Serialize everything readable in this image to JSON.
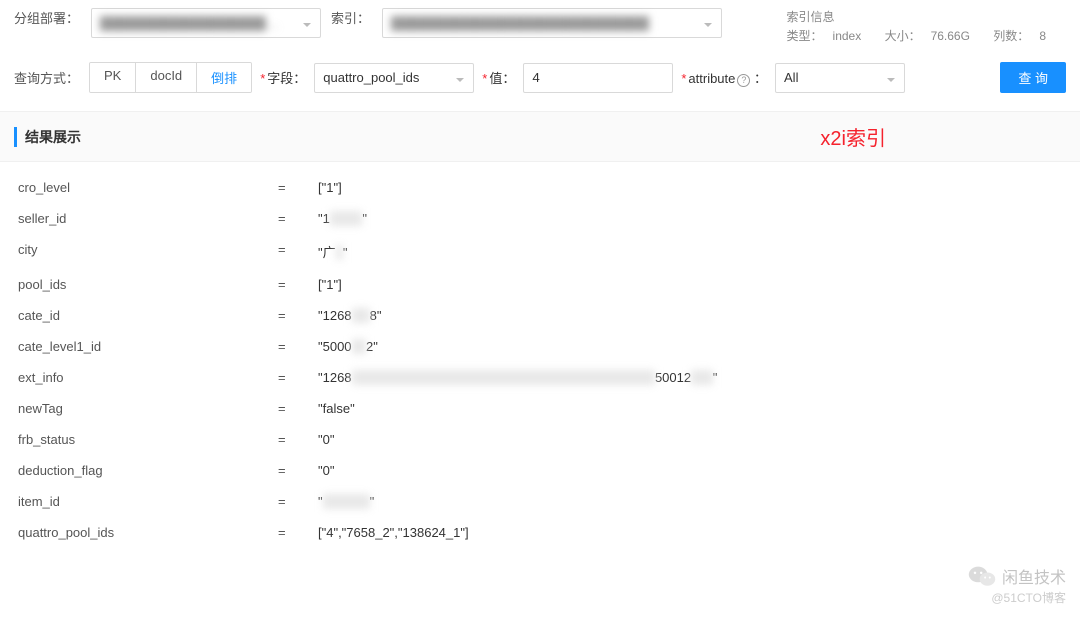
{
  "topbar": {
    "group_label": "分组部署：",
    "group_value": "██████████████████…",
    "index_label": "索引：",
    "index_value": "████████████████████████████"
  },
  "index_info": {
    "title": "索引信息",
    "type_label": "类型：",
    "type_value": "index",
    "size_label": "大小：",
    "size_value": "76.66G",
    "cols_label": "列数：",
    "cols_value": "8"
  },
  "query": {
    "method_label": "查询方式：",
    "method_options": {
      "pk": "PK",
      "docid": "docId",
      "inverted": "倒排"
    },
    "field_label": "字段：",
    "field_value": "quattro_pool_ids",
    "value_label": "值：",
    "value_value": "4",
    "attr_label": "attribute",
    "attr_value": "All",
    "submit": "查 询"
  },
  "section": {
    "title": "结果展示",
    "annotation": "x2i索引"
  },
  "results": [
    {
      "key": "cro_level",
      "val": "[\"1\"]"
    },
    {
      "key": "seller_id",
      "val": "\"1█████████\""
    },
    {
      "key": "city",
      "val": "\"广██\""
    },
    {
      "key": "pool_ids",
      "val": "[\"1\"]"
    },
    {
      "key": "cate_id",
      "val": "\"1268█████8\""
    },
    {
      "key": "cate_level1_id",
      "val": "\"5000████2\""
    },
    {
      "key": "ext_info",
      "val": "\"1268████████████████████████████████████████████████████████████████████████████████████50012██████\""
    },
    {
      "key": "newTag",
      "val": "\"false\""
    },
    {
      "key": "frb_status",
      "val": "\"0\""
    },
    {
      "key": "deduction_flag",
      "val": "\"0\""
    },
    {
      "key": "item_id",
      "val": "\"█████████████\""
    },
    {
      "key": "quattro_pool_ids",
      "val": "[\"4\",\"7658_2\",\"138624_1\"]"
    }
  ],
  "watermark": {
    "brand": "闲鱼技术",
    "source": "@51CTO博客"
  }
}
